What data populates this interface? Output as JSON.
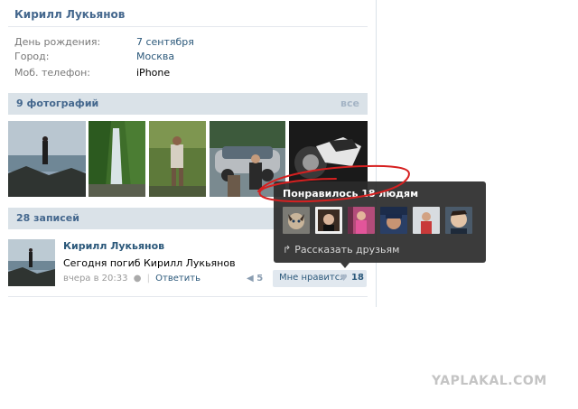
{
  "profile": {
    "name": "Кирилл Лукьянов",
    "info": [
      {
        "label": "День рождения:",
        "value": "7 сентября"
      },
      {
        "label": "Город:",
        "value": "Москва"
      },
      {
        "label": "Моб. телефон:",
        "value": "iPhone"
      }
    ]
  },
  "photos": {
    "title": "9 фотографий",
    "all_label": "все"
  },
  "posts": {
    "title": "28 записей",
    "item": {
      "author": "Кирилл Лукьянов",
      "text": "Сегодня погиб Кирилл Лукьянов",
      "time": "вчера в 20:33",
      "reply_label": "Ответить",
      "reposts": "5",
      "like_label": "Мне нравится",
      "like_count": "18"
    }
  },
  "likes_popup": {
    "title": "Понравилось 18 людям",
    "share_label": "Рассказать друзьям"
  },
  "watermark": "YAPLAKAL.COM",
  "colors": {
    "link": "#2b587a",
    "header_bg": "#dae2e8",
    "header_text": "#45688e",
    "scribble": "#d62020"
  }
}
